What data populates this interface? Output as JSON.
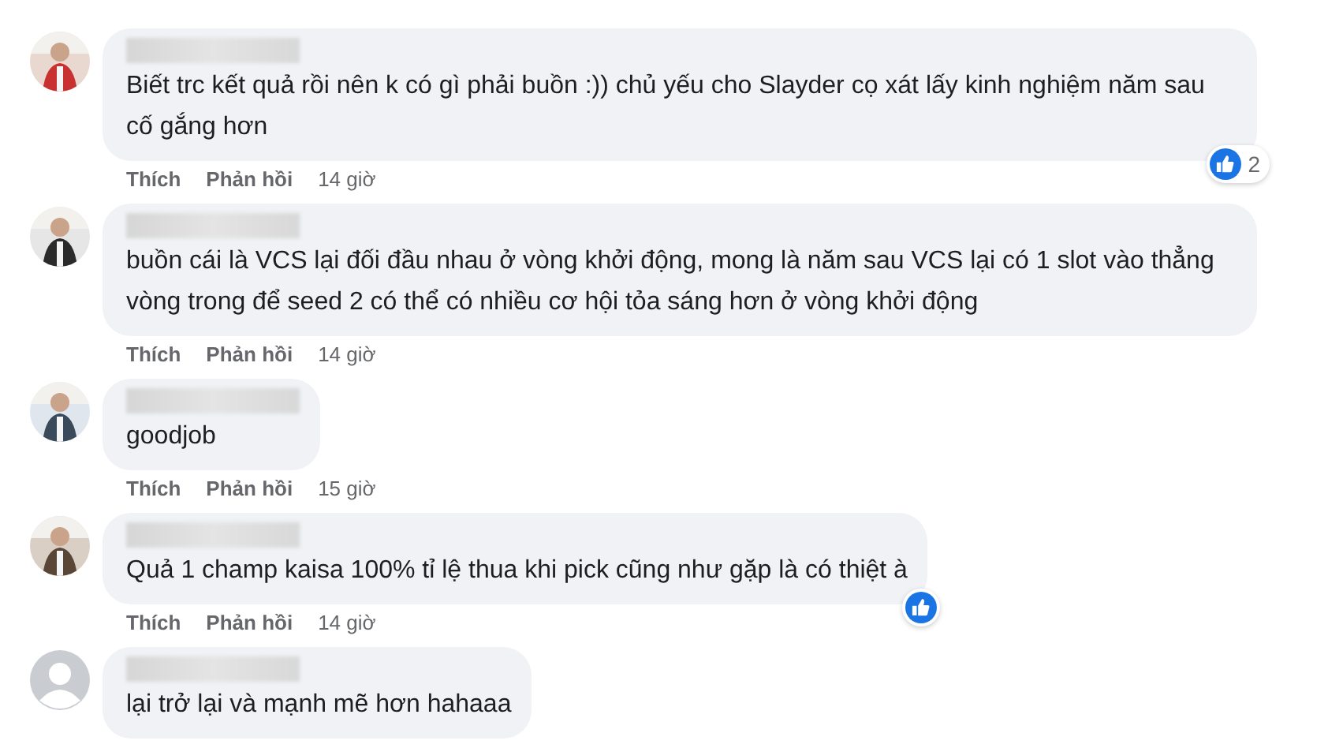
{
  "comments": [
    {
      "text": "Biết trc kết quả rồi nên k có gì phải buồn :)) chủ yếu cho Slayder cọ xát lấy kinh nghiệm năm sau cố gắng hơn",
      "reaction": true,
      "reaction_count": "2",
      "like": "Thích",
      "reply": "Phản hồi",
      "time": "14 giờ"
    },
    {
      "text": "buồn cái là VCS lại đối đầu nhau ở vòng khởi động, mong là năm sau VCS lại có 1 slot vào thẳng vòng trong để seed 2 có thể có nhiều cơ hội tỏa sáng hơn ở vòng khởi động",
      "reaction": false,
      "like": "Thích",
      "reply": "Phản hồi",
      "time": "14 giờ"
    },
    {
      "text": "goodjob",
      "reaction": false,
      "like": "Thích",
      "reply": "Phản hồi",
      "time": "15 giờ"
    },
    {
      "text": "Quả 1 champ kaisa 100% tỉ lệ thua khi pick cũng như gặp là có thiệt à",
      "reaction": true,
      "like": "Thích",
      "reply": "Phản hồi",
      "time": "14 giờ"
    },
    {
      "kind": "default",
      "text": "lại trở lại và mạnh mẽ hơn hahaaa",
      "reaction": false
    }
  ]
}
